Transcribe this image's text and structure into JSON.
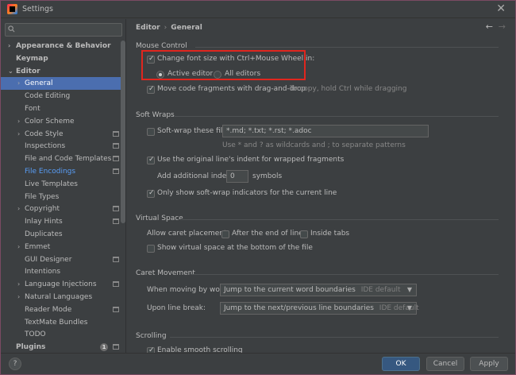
{
  "window": {
    "title": "Settings",
    "close": "✕"
  },
  "search": {
    "placeholder": ""
  },
  "sidebar": {
    "items": [
      {
        "label": "Appearance & Behavior",
        "level": 0,
        "arrow": "›",
        "bold": true
      },
      {
        "label": "Keymap",
        "level": 0,
        "arrow": "",
        "bold": true
      },
      {
        "label": "Editor",
        "level": 0,
        "arrow": "⌄",
        "bold": true
      },
      {
        "label": "General",
        "level": 1,
        "arrow": "›",
        "selected": true
      },
      {
        "label": "Code Editing",
        "level": 1,
        "arrow": ""
      },
      {
        "label": "Font",
        "level": 1,
        "arrow": ""
      },
      {
        "label": "Color Scheme",
        "level": 1,
        "arrow": "›"
      },
      {
        "label": "Code Style",
        "level": 1,
        "arrow": "›",
        "badge": true
      },
      {
        "label": "Inspections",
        "level": 1,
        "arrow": "",
        "badge": true
      },
      {
        "label": "File and Code Templates",
        "level": 1,
        "arrow": "",
        "badge": true
      },
      {
        "label": "File Encodings",
        "level": 1,
        "arrow": "",
        "badge": true,
        "link": true
      },
      {
        "label": "Live Templates",
        "level": 1,
        "arrow": ""
      },
      {
        "label": "File Types",
        "level": 1,
        "arrow": ""
      },
      {
        "label": "Copyright",
        "level": 1,
        "arrow": "›",
        "badge": true
      },
      {
        "label": "Inlay Hints",
        "level": 1,
        "arrow": "",
        "badge": true
      },
      {
        "label": "Duplicates",
        "level": 1,
        "arrow": ""
      },
      {
        "label": "Emmet",
        "level": 1,
        "arrow": "›"
      },
      {
        "label": "GUI Designer",
        "level": 1,
        "arrow": "",
        "badge": true
      },
      {
        "label": "Intentions",
        "level": 1,
        "arrow": ""
      },
      {
        "label": "Language Injections",
        "level": 1,
        "arrow": "›",
        "badge": true
      },
      {
        "label": "Natural Languages",
        "level": 1,
        "arrow": "›"
      },
      {
        "label": "Reader Mode",
        "level": 1,
        "arrow": "",
        "badge": true
      },
      {
        "label": "TextMate Bundles",
        "level": 1,
        "arrow": ""
      },
      {
        "label": "TODO",
        "level": 1,
        "arrow": ""
      },
      {
        "label": "Plugins",
        "level": 0,
        "arrow": "",
        "bold": true,
        "count": "1",
        "badge": true
      }
    ]
  },
  "breadcrumb": {
    "parent": "Editor",
    "sep": "›",
    "current": "General"
  },
  "nav": {
    "back": "←",
    "forward": "→"
  },
  "mouse_control": {
    "title": "Mouse Control",
    "change_font_size": "Change font size with Ctrl+Mouse Wheel in:",
    "active_editor": "Active editor",
    "all_editors": "All editors",
    "move_fragments": "Move code fragments with drag-and-drop",
    "move_hint": "To copy, hold Ctrl while dragging"
  },
  "soft_wraps": {
    "title": "Soft Wraps",
    "soft_wrap_files": "Soft-wrap these files:",
    "files_value": "*.md; *.txt; *.rst; *.adoc",
    "wildcard_hint": "Use * and ? as wildcards and ; to separate patterns",
    "use_original_indent": "Use the original line's indent for wrapped fragments",
    "add_indent_label": "Add additional indent:",
    "add_indent_value": "0",
    "symbols": "symbols",
    "show_indicators": "Only show soft-wrap indicators for the current line"
  },
  "virtual_space": {
    "title": "Virtual Space",
    "allow_caret": "Allow caret placement:",
    "after_end": "After the end of line",
    "inside_tabs": "Inside tabs",
    "show_virtual": "Show virtual space at the bottom of the file"
  },
  "caret_movement": {
    "title": "Caret Movement",
    "moving_by_words": "When moving by words:",
    "words_value": "Jump to the current word boundaries",
    "words_default": "IDE default",
    "upon_line_break": "Upon line break:",
    "line_value": "Jump to the next/previous line boundaries",
    "line_default": "IDE default"
  },
  "scrolling": {
    "title": "Scrolling",
    "smooth": "Enable smooth scrolling"
  },
  "footer": {
    "help": "?",
    "ok": "OK",
    "cancel": "Cancel",
    "apply": "Apply"
  }
}
